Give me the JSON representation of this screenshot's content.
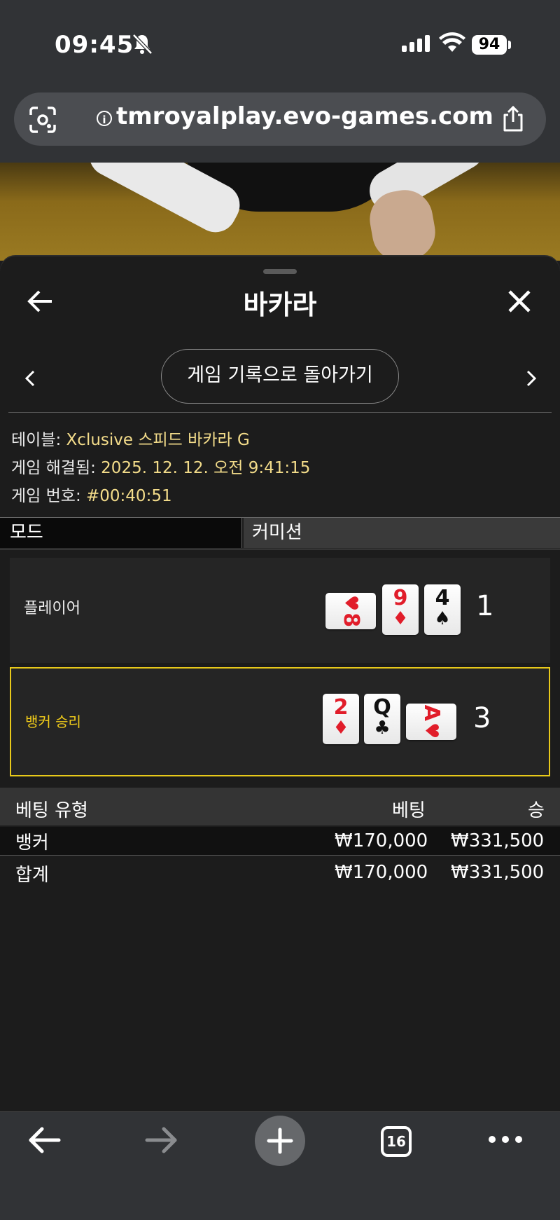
{
  "status_bar": {
    "time": "09:45",
    "battery": "94",
    "icons": [
      "bell-slash-icon",
      "signal-icon",
      "wifi-icon",
      "battery-icon"
    ]
  },
  "browser": {
    "url": "tmroyalplay.evo-games.com",
    "icons": [
      "lens-icon",
      "info-icon",
      "share-icon"
    ]
  },
  "sheet": {
    "title": "바카라",
    "history_button": "게임 기록으로 돌아가기",
    "info": {
      "table_label": "테이블: ",
      "table_value": "Xclusive 스피드 바카라 G",
      "resolved_label": "게임 해결됨: ",
      "resolved_value": "2025. 12. 12. 오전 9:41:15",
      "number_label": "게임 번호: ",
      "number_value": "#00:40:51"
    },
    "mode_label": "모드",
    "commission_label": "커미션"
  },
  "hands": {
    "player": {
      "label": "플레이어",
      "score": "1",
      "cards": [
        {
          "rank": "8",
          "suit": "♥",
          "color": "#e11d2a",
          "orientation": "horizontal"
        },
        {
          "rank": "9",
          "suit": "♦",
          "color": "#e11d2a",
          "orientation": "vertical"
        },
        {
          "rank": "4",
          "suit": "♠",
          "color": "#111111",
          "orientation": "vertical"
        }
      ]
    },
    "banker": {
      "label": "뱅커 승리",
      "score": "3",
      "cards": [
        {
          "rank": "2",
          "suit": "♦",
          "color": "#e11d2a",
          "orientation": "vertical"
        },
        {
          "rank": "Q",
          "suit": "♣",
          "color": "#111111",
          "orientation": "vertical"
        },
        {
          "rank": "A",
          "suit": "♥",
          "color": "#e11d2a",
          "orientation": "horizontal"
        }
      ],
      "highlight_color": "#e8c91a"
    }
  },
  "bets": {
    "headers": {
      "type": "베팅 유형",
      "bet": "베팅",
      "win": "승"
    },
    "rows": [
      {
        "type": "뱅커",
        "bet": "₩170,000",
        "win": "₩331,500"
      }
    ],
    "total": {
      "type": "합계",
      "bet": "₩170,000",
      "win": "₩331,500"
    }
  },
  "toolbar": {
    "tab_count": "16",
    "icons": [
      "back-arrow-icon",
      "forward-arrow-icon",
      "plus-icon",
      "tabs-icon",
      "more-icon"
    ]
  }
}
